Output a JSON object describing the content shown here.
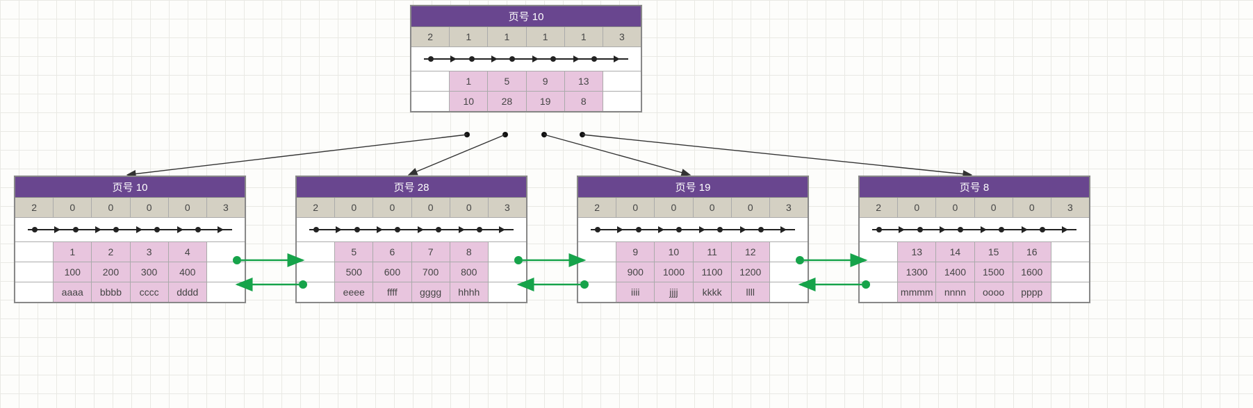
{
  "root": {
    "title": "页号 10",
    "counts": [
      "2",
      "1",
      "1",
      "1",
      "1",
      "3"
    ],
    "keys": [
      "1",
      "5",
      "9",
      "13"
    ],
    "ptrs": [
      "10",
      "28",
      "19",
      "8"
    ]
  },
  "leaves": [
    {
      "title": "页号 10",
      "counts": [
        "2",
        "0",
        "0",
        "0",
        "0",
        "3"
      ],
      "rows": [
        [
          "1",
          "2",
          "3",
          "4"
        ],
        [
          "100",
          "200",
          "300",
          "400"
        ],
        [
          "aaaa",
          "bbbb",
          "cccc",
          "dddd"
        ]
      ]
    },
    {
      "title": "页号 28",
      "counts": [
        "2",
        "0",
        "0",
        "0",
        "0",
        "3"
      ],
      "rows": [
        [
          "5",
          "6",
          "7",
          "8"
        ],
        [
          "500",
          "600",
          "700",
          "800"
        ],
        [
          "eeee",
          "ffff",
          "gggg",
          "hhhh"
        ]
      ]
    },
    {
      "title": "页号 19",
      "counts": [
        "2",
        "0",
        "0",
        "0",
        "0",
        "3"
      ],
      "rows": [
        [
          "9",
          "10",
          "11",
          "12"
        ],
        [
          "900",
          "1000",
          "1100",
          "1200"
        ],
        [
          "iiii",
          "jjjj",
          "kkkk",
          "llll"
        ]
      ]
    },
    {
      "title": "页号 8",
      "counts": [
        "2",
        "0",
        "0",
        "0",
        "0",
        "3"
      ],
      "rows": [
        [
          "13",
          "14",
          "15",
          "16"
        ],
        [
          "1300",
          "1400",
          "1500",
          "1600"
        ],
        [
          "mmmm",
          "nnnn",
          "oooo",
          "pppp"
        ]
      ]
    }
  ],
  "chart_data": {
    "type": "table",
    "description": "B+ tree index page layout. Root internal node points to 4 leaf data pages.",
    "root_node": {
      "page_no": 10,
      "header": [
        2,
        1,
        1,
        1,
        1,
        3
      ],
      "keys": [
        1,
        5,
        9,
        13
      ],
      "child_page_nos": [
        10,
        28,
        19,
        8
      ]
    },
    "leaf_nodes": [
      {
        "page_no": 10,
        "header": [
          2,
          0,
          0,
          0,
          0,
          3
        ],
        "records": [
          {
            "k": 1,
            "v1": 100,
            "v2": "aaaa"
          },
          {
            "k": 2,
            "v1": 200,
            "v2": "bbbb"
          },
          {
            "k": 3,
            "v1": 300,
            "v2": "cccc"
          },
          {
            "k": 4,
            "v1": 400,
            "v2": "dddd"
          }
        ]
      },
      {
        "page_no": 28,
        "header": [
          2,
          0,
          0,
          0,
          0,
          3
        ],
        "records": [
          {
            "k": 5,
            "v1": 500,
            "v2": "eeee"
          },
          {
            "k": 6,
            "v1": 600,
            "v2": "ffff"
          },
          {
            "k": 7,
            "v1": 700,
            "v2": "gggg"
          },
          {
            "k": 8,
            "v1": 800,
            "v2": "hhhh"
          }
        ]
      },
      {
        "page_no": 19,
        "header": [
          2,
          0,
          0,
          0,
          0,
          3
        ],
        "records": [
          {
            "k": 9,
            "v1": 900,
            "v2": "iiii"
          },
          {
            "k": 10,
            "v1": 1000,
            "v2": "jjjj"
          },
          {
            "k": 11,
            "v1": 1100,
            "v2": "kkkk"
          },
          {
            "k": 12,
            "v1": 1200,
            "v2": "llll"
          }
        ]
      },
      {
        "page_no": 8,
        "header": [
          2,
          0,
          0,
          0,
          0,
          3
        ],
        "records": [
          {
            "k": 13,
            "v1": 1300,
            "v2": "mmmm"
          },
          {
            "k": 14,
            "v1": 1400,
            "v2": "nnnn"
          },
          {
            "k": 15,
            "v1": 1500,
            "v2": "oooo"
          },
          {
            "k": 16,
            "v1": 1600,
            "v2": "pppp"
          }
        ]
      }
    ],
    "sibling_links": "doubly-linked between adjacent leaves (green arrows)"
  }
}
